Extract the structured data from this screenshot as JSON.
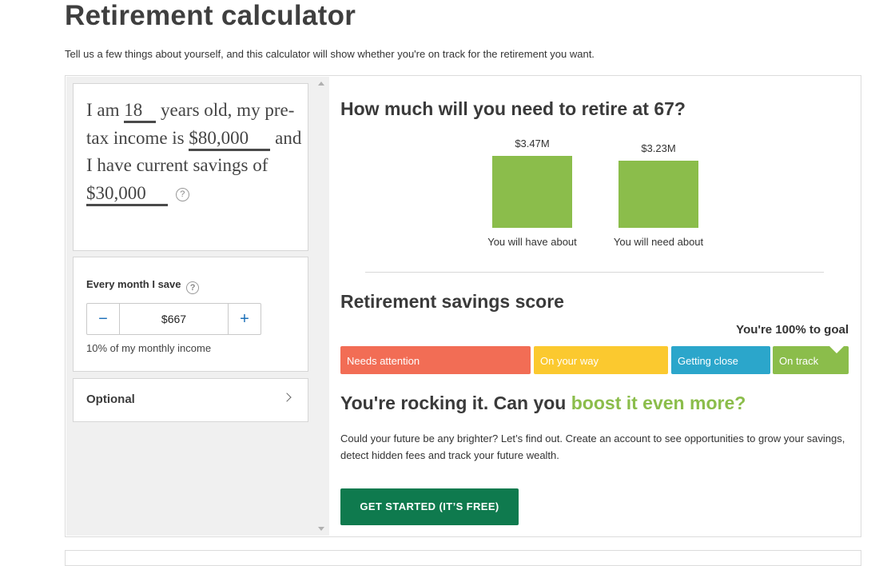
{
  "page": {
    "title": "Retirement calculator",
    "subtitle": "Tell us a few things about yourself, and this calculator will show whether you're on track for the retirement you want."
  },
  "intro": {
    "part1": "I am",
    "age": "18",
    "part2": "years old, my pre-tax income is",
    "income": "$80,000",
    "part3": "and I have current savings of",
    "savings": "$30,000",
    "help": "?"
  },
  "monthly": {
    "label": "Every month I save",
    "help": "?",
    "minus": "−",
    "value": "$667",
    "plus": "+",
    "note": "10% of my monthly income"
  },
  "optional": {
    "label": "Optional"
  },
  "need": {
    "heading": "How much will you need to retire at 67?",
    "bars": [
      {
        "value": "$3.47M",
        "caption": "You will have about",
        "amount_millions": 3.47
      },
      {
        "value": "$3.23M",
        "caption": "You will need about",
        "amount_millions": 3.23
      }
    ]
  },
  "score": {
    "heading": "Retirement savings score",
    "goal": "You're 100% to goal",
    "segments": [
      {
        "label": "Needs attention",
        "color": "#f26d55"
      },
      {
        "label": "On your way",
        "color": "#fbc92f"
      },
      {
        "label": "Getting close",
        "color": "#2ba6cb"
      },
      {
        "label": "On track",
        "color": "#8bbd4b"
      }
    ]
  },
  "cta": {
    "heading_lead": "You're rocking it. Can you ",
    "heading_highlight": "boost it even more?",
    "body": "Could your future be any brighter? Let’s find out. Create an account to see opportunities to grow your savings, detect hidden fees and track your future wealth.",
    "button": "GET STARTED (IT’S FREE)"
  },
  "colors": {
    "accent_green": "#8bbd4b",
    "cta_green": "#0f7a4e",
    "link_blue": "#1b6fb8"
  }
}
